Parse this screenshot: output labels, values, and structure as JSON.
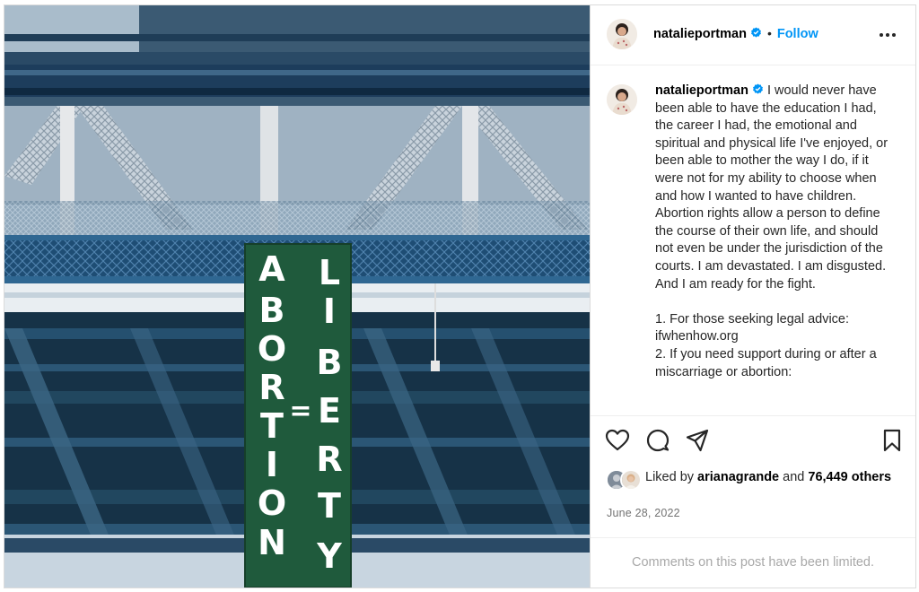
{
  "post": {
    "username": "natalieportman",
    "follow_label": "Follow",
    "separator": "•",
    "caption_text": "I would never have been able to have the education I had, the career I had, the emotional and spiritual and physical life I've enjoyed, or been able to mother the way I do, if it were not for my ability to choose when and how I wanted to have children. Abortion rights allow a person to define the course of their own life, and should not even be under the jurisdiction of the courts. I am devastated. I am disgusted. And I am ready for the fight.\n\n1. For those seeking legal advice: ifwhenhow.org\n2. If you need support during or after a miscarriage or abortion:",
    "liked_by_prefix": "Liked by",
    "liked_by_user": "ariangrande",
    "liked_by_user_display": "arianagrande",
    "liked_and": "and",
    "likes_count": "76,449 others",
    "date": "June 28, 2022",
    "comments_notice": "Comments on this post have been limited."
  },
  "banner": {
    "left_text": "ABORTION",
    "equals": "=",
    "right_text": "LIBERTY",
    "color": "#1f5a3c"
  },
  "icons": {
    "verified": "verified-badge-icon",
    "more": "more-options-icon",
    "like": "heart-icon",
    "comment": "comment-icon",
    "share": "paper-plane-icon",
    "save": "bookmark-icon"
  },
  "colors": {
    "accent": "#0095f6",
    "muted": "#737373",
    "border": "#dbdbdb"
  }
}
